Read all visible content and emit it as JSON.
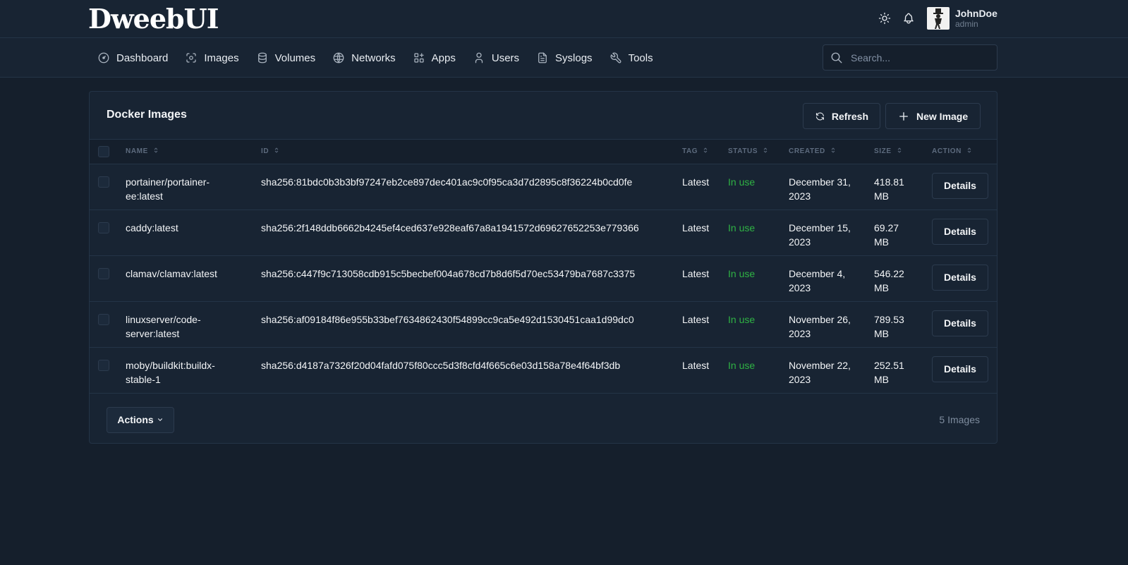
{
  "header": {
    "logo": "DweebUI",
    "user_name": "JohnDoe",
    "user_role": "admin"
  },
  "nav": {
    "items": [
      {
        "label": "Dashboard",
        "icon": "dashboard-icon"
      },
      {
        "label": "Images",
        "icon": "images-icon"
      },
      {
        "label": "Volumes",
        "icon": "database-icon"
      },
      {
        "label": "Networks",
        "icon": "globe-icon"
      },
      {
        "label": "Apps",
        "icon": "apps-icon"
      },
      {
        "label": "Users",
        "icon": "user-icon"
      },
      {
        "label": "Syslogs",
        "icon": "file-icon"
      },
      {
        "label": "Tools",
        "icon": "wrench-icon"
      }
    ],
    "search_placeholder": "Search..."
  },
  "card": {
    "title": "Docker Images",
    "refresh_label": "Refresh",
    "new_image_label": "New Image",
    "columns": [
      "Name",
      "ID",
      "Tag",
      "Status",
      "Created",
      "Size",
      "Action"
    ],
    "rows": [
      {
        "name": "portainer/portainer-ee:latest",
        "id": "sha256:81bdc0b3b3bf97247eb2ce897dec401ac9c0f95ca3d7d2895c8f36224b0cd0fe",
        "tag": "Latest",
        "status": "In use",
        "created": "December 31, 2023",
        "size": "418.81 MB",
        "action": "Details"
      },
      {
        "name": "caddy:latest",
        "id": "sha256:2f148ddb6662b4245ef4ced637e928eaf67a8a1941572d69627652253e779366",
        "tag": "Latest",
        "status": "In use",
        "created": "December 15, 2023",
        "size": "69.27 MB",
        "action": "Details"
      },
      {
        "name": "clamav/clamav:latest",
        "id": "sha256:c447f9c713058cdb915c5becbef004a678cd7b8d6f5d70ec53479ba7687c3375",
        "tag": "Latest",
        "status": "In use",
        "created": "December 4, 2023",
        "size": "546.22 MB",
        "action": "Details"
      },
      {
        "name": "linuxserver/code-server:latest",
        "id": "sha256:af09184f86e955b33bef7634862430f54899cc9ca5e492d1530451caa1d99dc0",
        "tag": "Latest",
        "status": "In use",
        "created": "November 26, 2023",
        "size": "789.53 MB",
        "action": "Details"
      },
      {
        "name": "moby/buildkit:buildx-stable-1",
        "id": "sha256:d4187a7326f20d04fafd075f80ccc5d3f8cfd4f665c6e03d158a78e4f64bf3db",
        "tag": "Latest",
        "status": "In use",
        "created": "November 22, 2023",
        "size": "252.51 MB",
        "action": "Details"
      }
    ],
    "actions_label": "Actions",
    "count_label": "5 Images"
  },
  "colors": {
    "background": "#151f2c",
    "surface": "#182433",
    "border": "#243447",
    "status_green": "#2fb344"
  }
}
